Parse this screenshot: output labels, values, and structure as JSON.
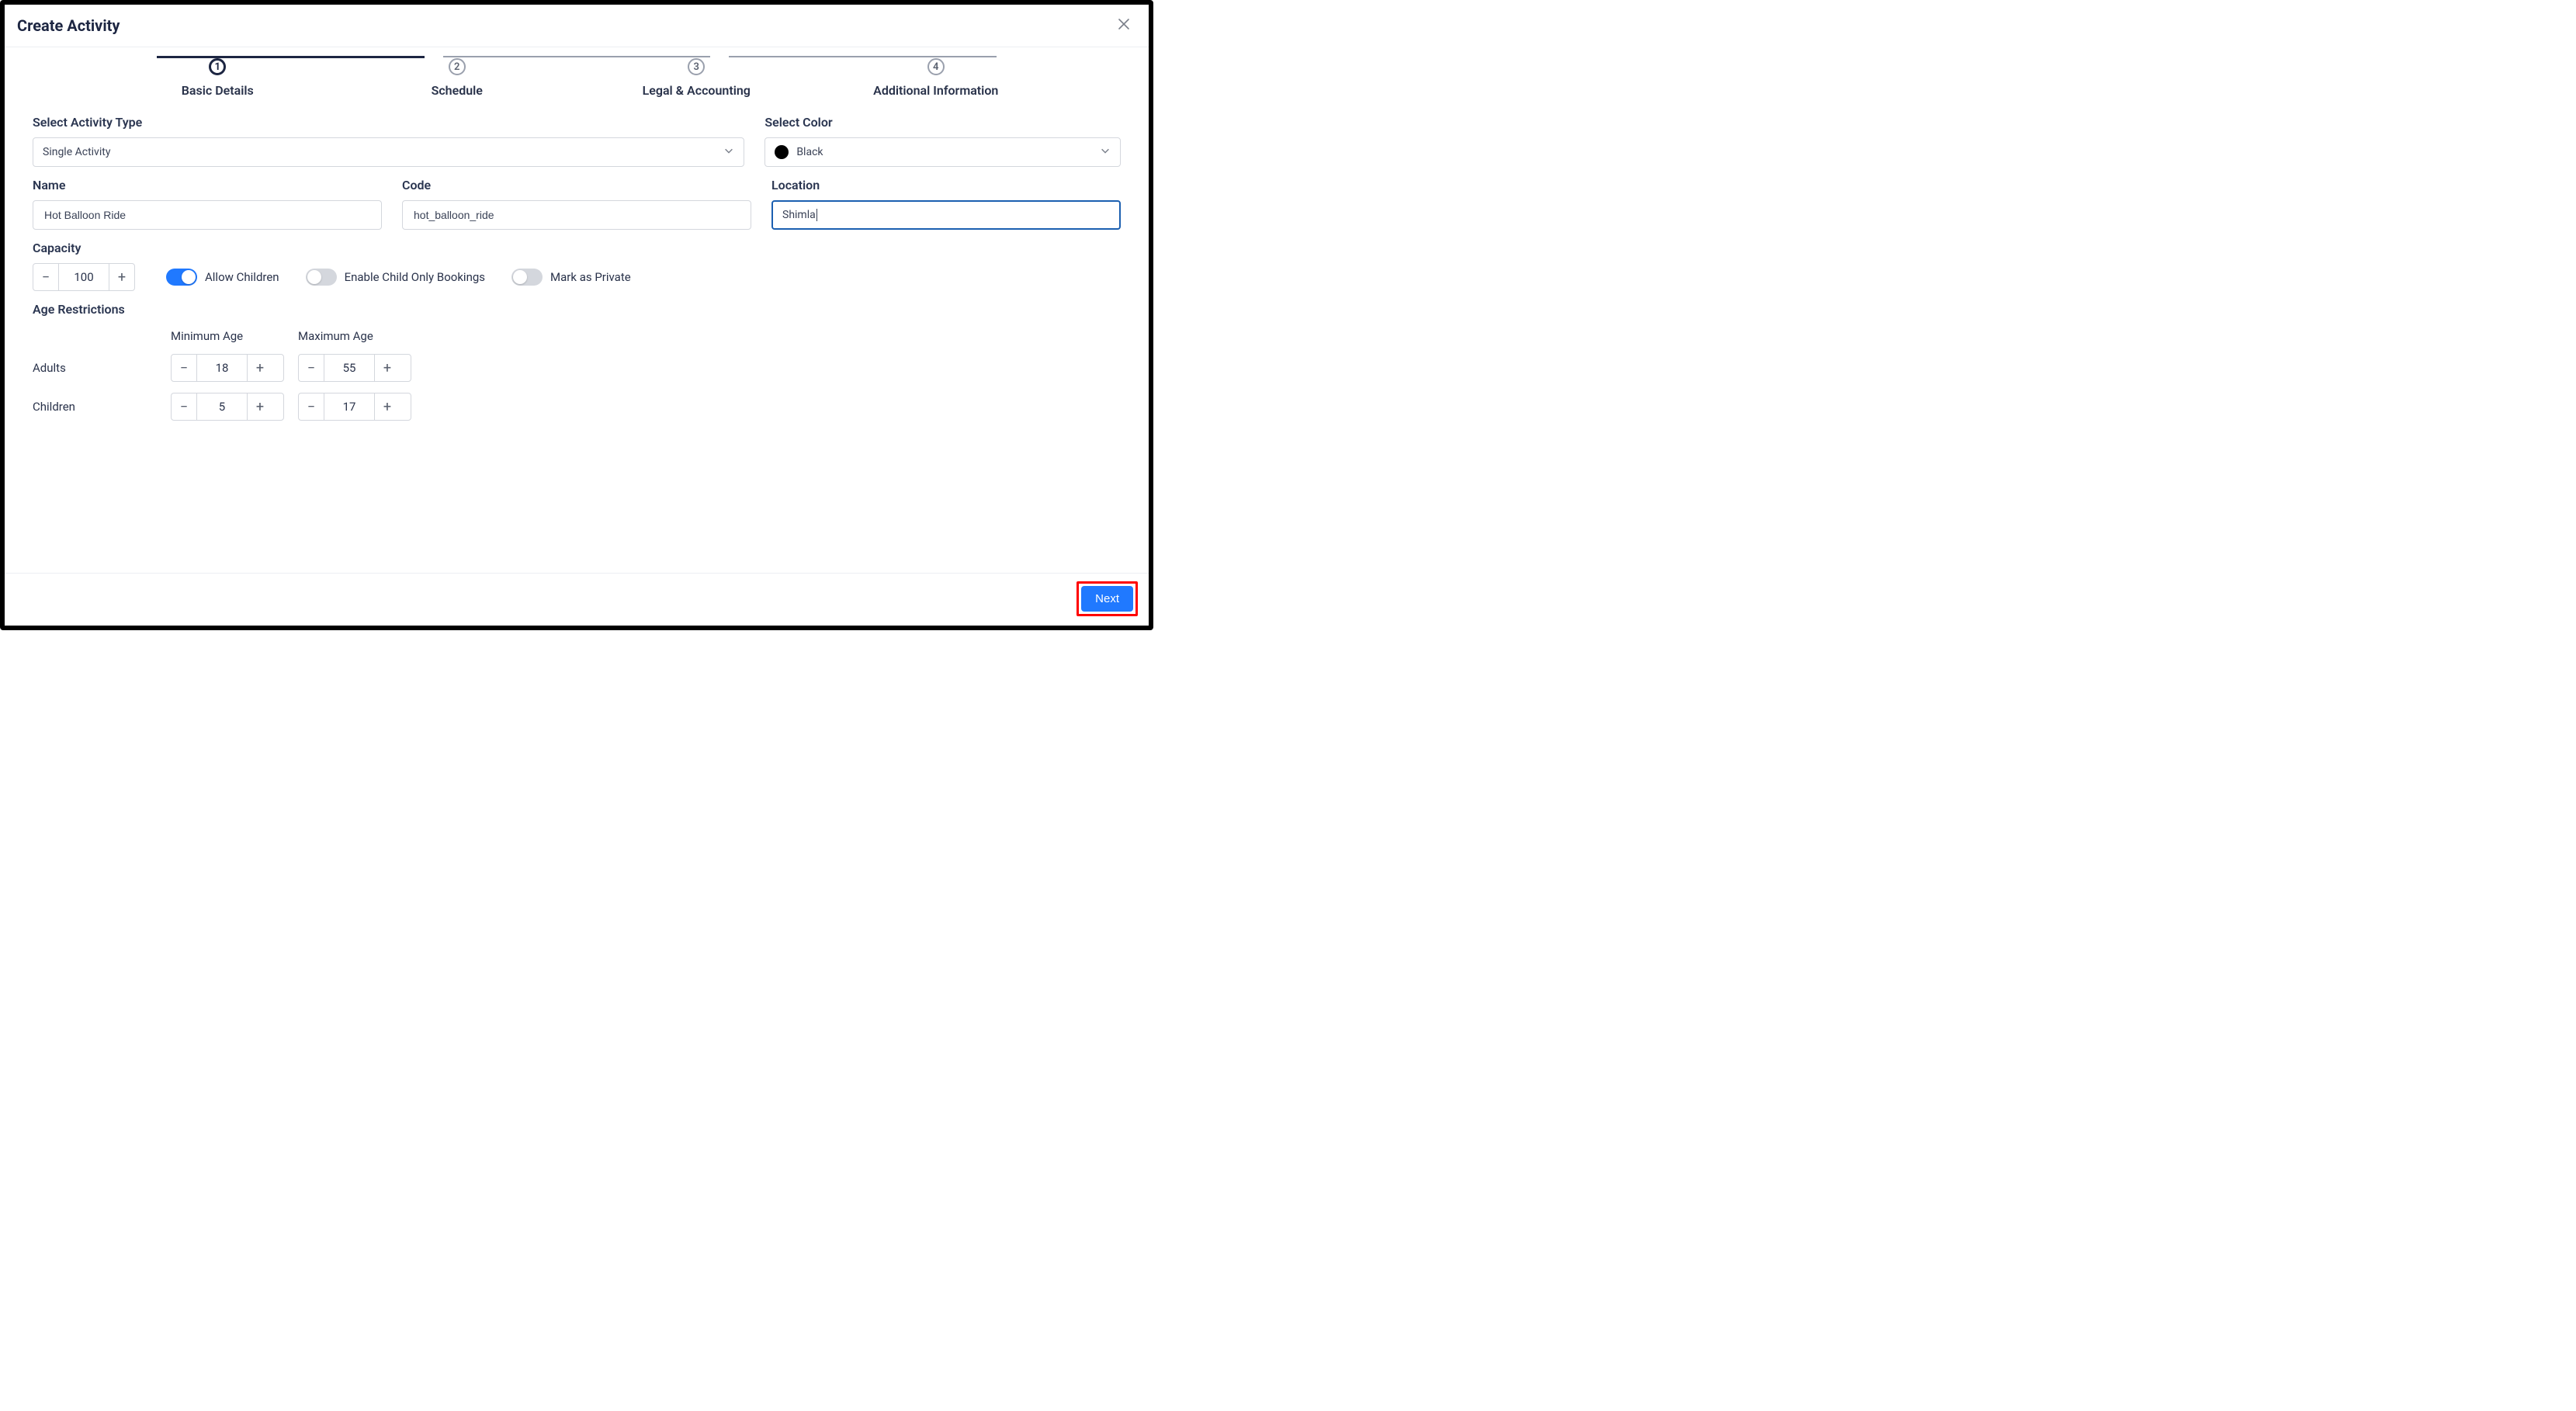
{
  "header": {
    "title": "Create Activity"
  },
  "stepper": {
    "steps": [
      {
        "num": "1",
        "label": "Basic Details",
        "active": true
      },
      {
        "num": "2",
        "label": "Schedule",
        "active": false
      },
      {
        "num": "3",
        "label": "Legal & Accounting",
        "active": false
      },
      {
        "num": "4",
        "label": "Additional Information",
        "active": false
      }
    ]
  },
  "form": {
    "activity_type": {
      "label": "Select Activity Type",
      "value": "Single Activity"
    },
    "color": {
      "label": "Select Color",
      "value": "Black",
      "hex": "#000000"
    },
    "name": {
      "label": "Name",
      "value": "Hot Balloon Ride"
    },
    "code": {
      "label": "Code",
      "value": "hot_balloon_ride"
    },
    "location": {
      "label": "Location",
      "value": "Shimla"
    },
    "capacity": {
      "label": "Capacity",
      "value": "100"
    },
    "toggles": {
      "allow_children": {
        "label": "Allow Children",
        "on": true
      },
      "child_only": {
        "label": "Enable Child Only Bookings",
        "on": false
      },
      "mark_private": {
        "label": "Mark as Private",
        "on": false
      }
    },
    "age": {
      "section_label": "Age Restrictions",
      "min_label": "Minimum Age",
      "max_label": "Maximum Age",
      "adults_label": "Adults",
      "children_label": "Children",
      "adults": {
        "min": "18",
        "max": "55"
      },
      "children": {
        "min": "5",
        "max": "17"
      }
    }
  },
  "footer": {
    "next_label": "Next"
  }
}
